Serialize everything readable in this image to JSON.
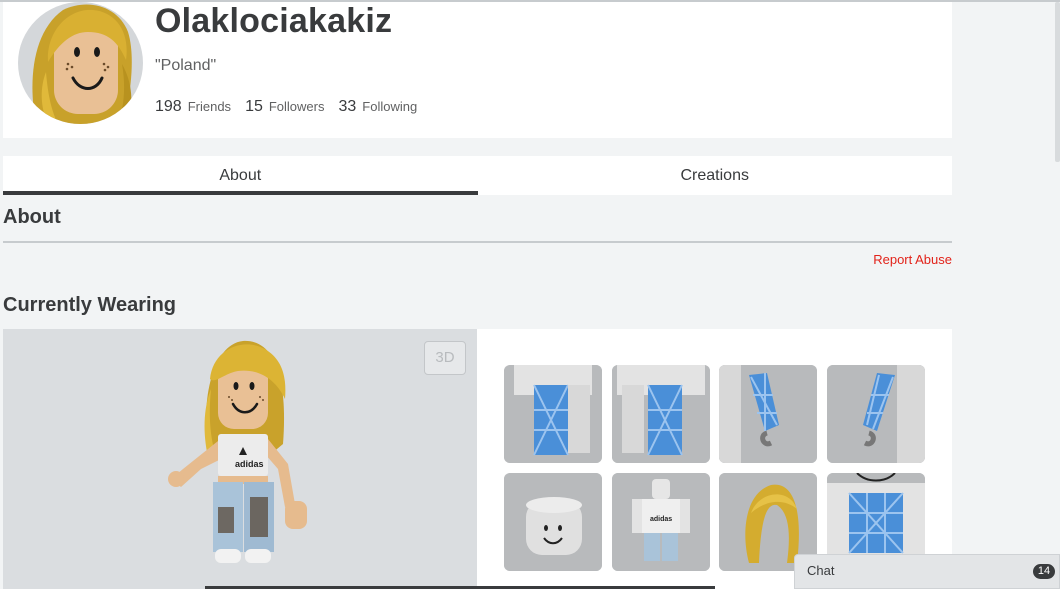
{
  "profile": {
    "username": "Olaklociakakiz",
    "status": "\"Poland\"",
    "friends_count": "198",
    "friends_label": "Friends",
    "followers_count": "15",
    "followers_label": "Followers",
    "following_count": "33",
    "following_label": "Following"
  },
  "tabs": [
    {
      "label": "About",
      "active": true
    },
    {
      "label": "Creations",
      "active": false
    }
  ],
  "about": {
    "title": "About",
    "report_label": "Report Abuse"
  },
  "wearing": {
    "title": "Currently Wearing",
    "btn_3d": "3D",
    "items": [
      {
        "icon": "fishnet-pants-left-icon"
      },
      {
        "icon": "fishnet-pants-right-icon"
      },
      {
        "icon": "fishnet-arm-left-icon"
      },
      {
        "icon": "fishnet-arm-right-icon"
      },
      {
        "icon": "smile-face-head-icon"
      },
      {
        "icon": "adidas-shirt-icon"
      },
      {
        "icon": "blonde-hair-icon"
      },
      {
        "icon": "fishnet-top-icon"
      }
    ]
  },
  "chat": {
    "label": "Chat",
    "badge": "14"
  },
  "colors": {
    "accent_report": "#e2231a",
    "text": "#393b3d",
    "background": "#f2f4f5"
  }
}
